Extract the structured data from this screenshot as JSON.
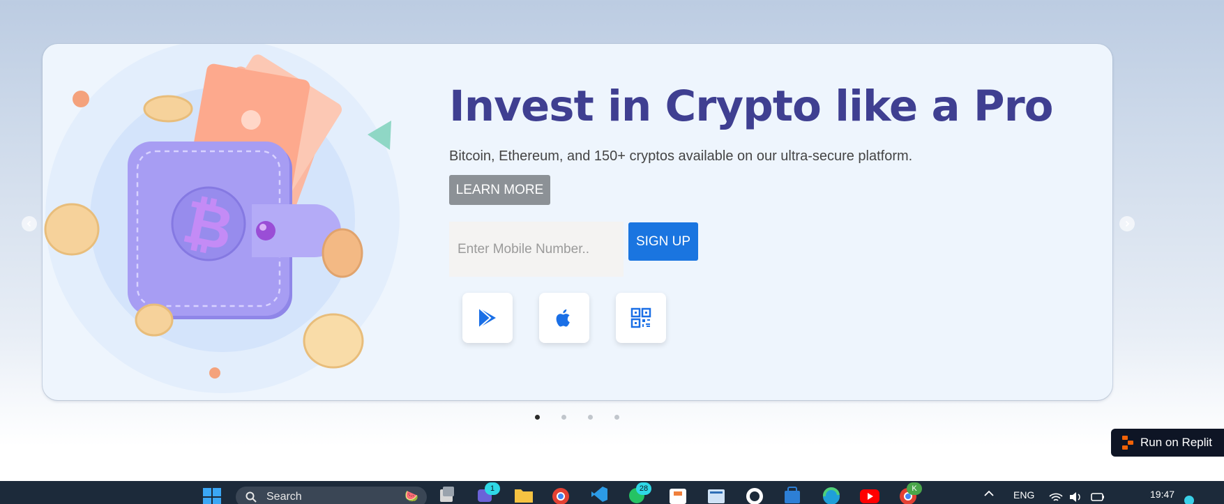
{
  "hero": {
    "title": "Invest in Crypto like a Pro",
    "subtitle": "Bitcoin, Ethereum, and 150+ cryptos available on our ultra-secure platform.",
    "learn_more_label": "LEARN MORE",
    "mobile_placeholder": "Enter Mobile Number..",
    "signup_label": "SIGN UP",
    "store_icons": [
      "google-play-icon",
      "apple-icon",
      "qr-code-icon"
    ]
  },
  "carousel": {
    "slide_count": 4,
    "active_index": 0
  },
  "replit": {
    "label": "Run on Replit"
  },
  "taskbar": {
    "search_label": "Search",
    "teams_badge": "1",
    "whatsapp_badge": "28",
    "profile_initial": "K",
    "language": "ENG",
    "time": "19:47"
  },
  "colors": {
    "title": "#3f3f91",
    "signup": "#1a75e0",
    "learn_more": "#8c9196",
    "card_bg": "#eef5fd"
  }
}
